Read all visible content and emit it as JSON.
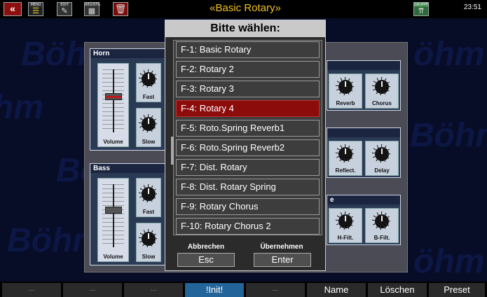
{
  "topbar": {
    "back_glyph": "«",
    "menu_caption": "MENÜ",
    "edit_caption": "EDIT",
    "registr_caption": "REGISTR.",
    "gruppe_caption": "GRUPPE",
    "title": "«Basic Rotary»",
    "clock": "23:51"
  },
  "panel": {
    "horn": {
      "title": "Horn",
      "volume_label": "Volume",
      "fast_label": "Fast",
      "slow_label": "Slow"
    },
    "bass": {
      "title": "Bass",
      "volume_label": "Volume",
      "fast_label": "Fast",
      "slow_label": "Slow"
    },
    "knobs_right": {
      "reverb": "Reverb",
      "chorus": "Chorus",
      "reflect": "Reflect.",
      "delay": "Delay",
      "hfilt": "H-Filt.",
      "bfilt": "B-Filt."
    },
    "group3_title_fragment": "e"
  },
  "modal": {
    "heading": "Bitte wählen:",
    "items": [
      "F-1: Basic Rotary",
      "F-2: Rotary 2",
      "F-3: Rotary 3",
      "F-4: Rotary 4",
      "F-5: Roto.Spring Reverb1",
      "F-6: Roto.Spring Reverb2",
      "F-7: Dist. Rotary",
      "F-8: Dist. Rotary Spring",
      "F-9: Rotary Chorus",
      "F-10: Rotary Chorus 2"
    ],
    "selected_index": 3,
    "cancel_label": "Abbrechen",
    "cancel_key": "Esc",
    "accept_label": "Übernehmen",
    "accept_key": "Enter"
  },
  "softkeys": [
    "---",
    "---",
    "---",
    "!Init!",
    "---",
    "Name",
    "Löschen",
    "Preset"
  ],
  "colors": {
    "accent_title": "#f0c020",
    "selected_row": "#8c0c0c",
    "init_key": "#23649a",
    "background": "#070d26"
  }
}
